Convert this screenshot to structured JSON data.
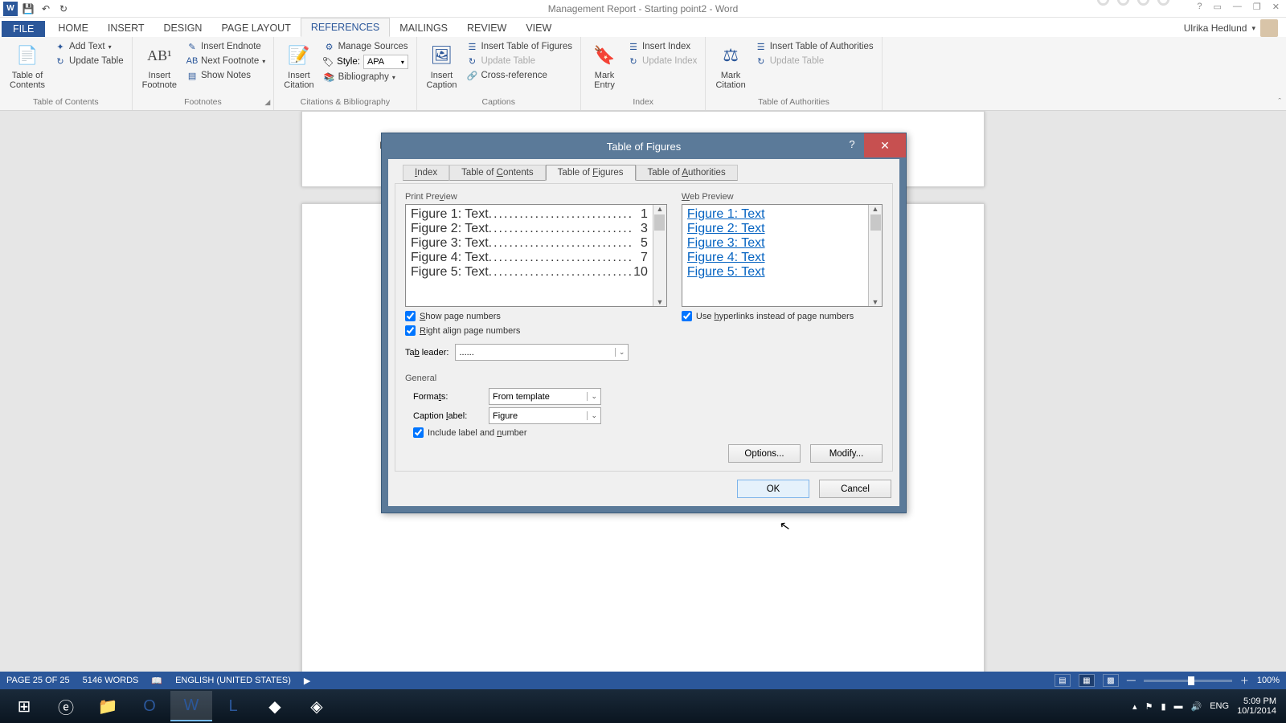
{
  "app": {
    "title": "Management Report - Starting point2 - Word",
    "account_name": "Ulrika Hedlund"
  },
  "qat": {
    "word": "W",
    "save": "💾",
    "undo": "↶",
    "redo": "↻"
  },
  "tabs": {
    "file": "FILE",
    "home": "HOME",
    "insert": "INSERT",
    "design": "DESIGN",
    "page_layout": "PAGE LAYOUT",
    "references": "REFERENCES",
    "mailings": "MAILINGS",
    "review": "REVIEW",
    "view": "VIEW"
  },
  "ribbon": {
    "toc": {
      "big": "Table of\nContents",
      "add_text": "Add Text",
      "update": "Update Table",
      "group": "Table of Contents"
    },
    "footnotes": {
      "big": "Insert\nFootnote",
      "ab": "AB¹",
      "endnote": "Insert Endnote",
      "next": "Next Footnote",
      "show": "Show Notes",
      "group": "Footnotes"
    },
    "citations": {
      "big": "Insert\nCitation",
      "manage": "Manage Sources",
      "style_label": "Style:",
      "style_value": "APA",
      "biblio": "Bibliography",
      "group": "Citations & Bibliography"
    },
    "captions": {
      "big": "Insert\nCaption",
      "insert_tof": "Insert Table of Figures",
      "update": "Update Table",
      "xref": "Cross-reference",
      "group": "Captions"
    },
    "index": {
      "big": "Mark\nEntry",
      "insert": "Insert Index",
      "update": "Update Index",
      "group": "Index"
    },
    "toa": {
      "big": "Mark\nCitation",
      "insert": "Insert Table of Authorities",
      "update": "Update Table",
      "group": "Table of Authorities"
    }
  },
  "page_letter": "B",
  "dialog": {
    "title": "Table of Figures",
    "tabs": {
      "index": "Index",
      "toc": "Table of Contents",
      "tof": "Table of Figures",
      "toa": "Table of Authorities"
    },
    "print_preview_label": "Print Preview",
    "web_preview_label": "Web Preview",
    "print_lines": [
      {
        "label": "Figure 1: Text",
        "page": "1"
      },
      {
        "label": "Figure 2: Text",
        "page": "3"
      },
      {
        "label": "Figure 3: Text",
        "page": "5"
      },
      {
        "label": "Figure 4: Text",
        "page": "7"
      },
      {
        "label": "Figure 5: Text",
        "page": "10"
      }
    ],
    "web_lines": [
      "Figure 1: Text",
      "Figure 2: Text",
      "Figure 3: Text",
      "Figure 4: Text",
      "Figure 5: Text"
    ],
    "show_page_numbers": "Show page numbers",
    "right_align": "Right align page numbers",
    "use_hyperlinks": "Use hyperlinks instead of page numbers",
    "tab_leader_label": "Tab leader:",
    "tab_leader_value": "......",
    "general_label": "General",
    "formats_label": "Formats:",
    "formats_value": "From template",
    "caption_label_label": "Caption label:",
    "caption_label_value": "Figure",
    "include_label": "Include label and number",
    "options": "Options...",
    "modify": "Modify...",
    "ok": "OK",
    "cancel": "Cancel"
  },
  "status": {
    "page": "PAGE 25 OF 25",
    "words": "5146 WORDS",
    "lang": "ENGLISH (UNITED STATES)",
    "zoom": "100%"
  },
  "tray": {
    "lang": "ENG",
    "time": "5:09 PM",
    "date": "10/1/2014"
  }
}
